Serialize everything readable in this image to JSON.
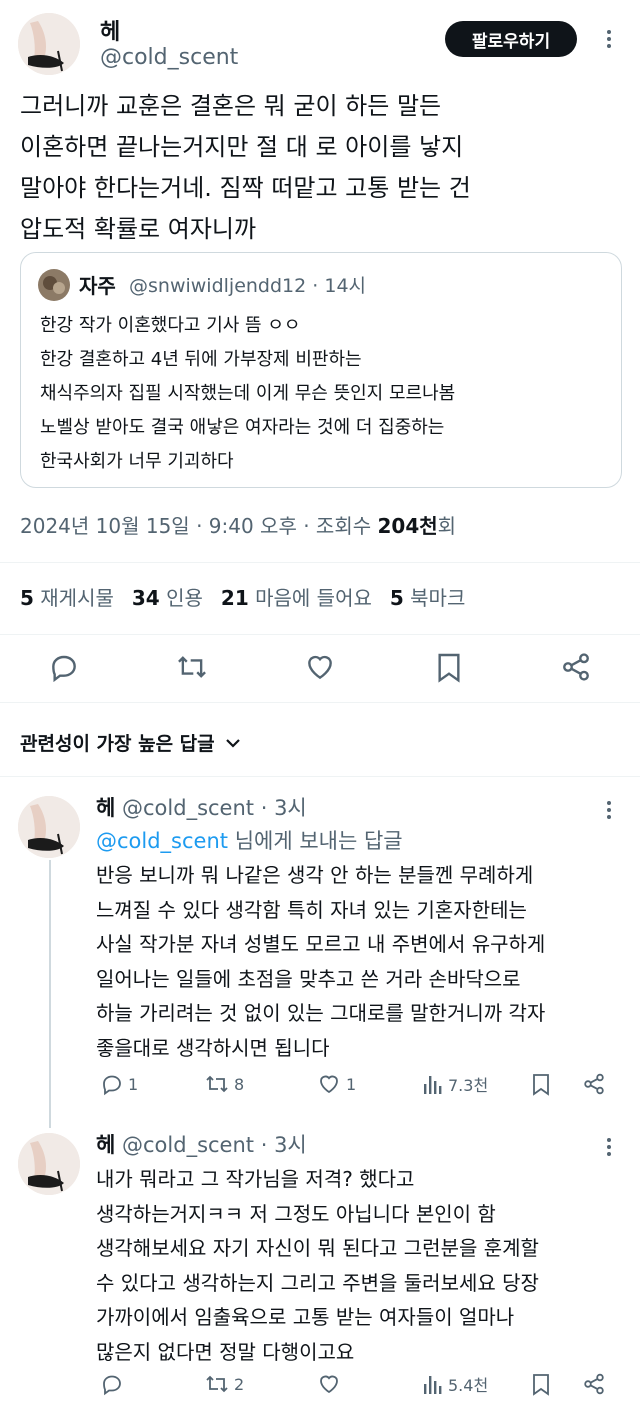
{
  "tweet": {
    "author_name": "헤",
    "author_handle": "@cold_scent",
    "follow_label": "팔로우하기",
    "text": "그러니까 교훈은 결혼은 뭐 굳이 하든 말든\n이혼하면 끝나는거지만 절 대 로 아이를 낳지\n말아야 한다는거네. 짐짝 떠맡고 고통 받는 건\n압도적 확률로 여자니까",
    "quote": {
      "name": "자주",
      "handle": "@snwiwidljendd12",
      "time": "14시",
      "text": "한강 작가 이혼했다고 기사 뜸 ㅇㅇ\n한강 결혼하고 4년 뒤에 가부장제 비판하는\n채식주의자 집필 시작했는데 이게 무슨 뜻인지 모르나봄\n노벨상 받아도 결국 애낳은 여자라는 것에 더 집중하는\n한국사회가 너무 기괴하다"
    },
    "timestamp": "2024년 10월 15일 · 9:40 오후 · 조회수 ",
    "views_bold": "204천",
    "views_suffix": "회",
    "stats": [
      {
        "count": "5",
        "label": "재게시물"
      },
      {
        "count": "34",
        "label": "인용"
      },
      {
        "count": "21",
        "label": "마음에 들어요"
      },
      {
        "count": "5",
        "label": "북마크"
      }
    ]
  },
  "replies_sort_label": "관련성이 가장 높은 답글",
  "replies": [
    {
      "name": "헤",
      "handle": "@cold_scent",
      "time": "· 3시",
      "replying_to_handle": "@cold_scent",
      "replying_to_suffix": " 님에게 보내는 답글",
      "text": "반응 보니까 뭐 나같은 생각 안 하는 분들껜 무례하게\n느껴질 수 있다 생각함 특히 자녀 있는 기혼자한테는\n사실 작가분 자녀 성별도 모르고 내 주변에서 유구하게\n일어나는 일들에 초점을 맞추고 쓴 거라 손바닥으로\n하늘 가리려는 것 없이 있는 그대로를 말한거니까 각자\n좋을대로 생각하시면 됩니다",
      "reply_count": "1",
      "retweet_count": "8",
      "like_count": "1",
      "view_count": "7.3천"
    },
    {
      "name": "헤",
      "handle": "@cold_scent",
      "time": "· 3시",
      "text": "내가 뭐라고 그 작가님을 저격? 했다고\n생각하는거지ㅋㅋ 저 그정도 아닙니다 본인이 함\n생각해보세요 자기 자신이 뭐 된다고 그런분을 훈계할\n수 있다고 생각하는지 그리고 주변을 둘러보세요 당장\n가까이에서 임출육으로 고통 받는 여자들이 얼마나\n많은지 없다면 정말 다행이고요",
      "reply_count": "",
      "retweet_count": "2",
      "like_count": "",
      "view_count": "5.4천"
    }
  ]
}
